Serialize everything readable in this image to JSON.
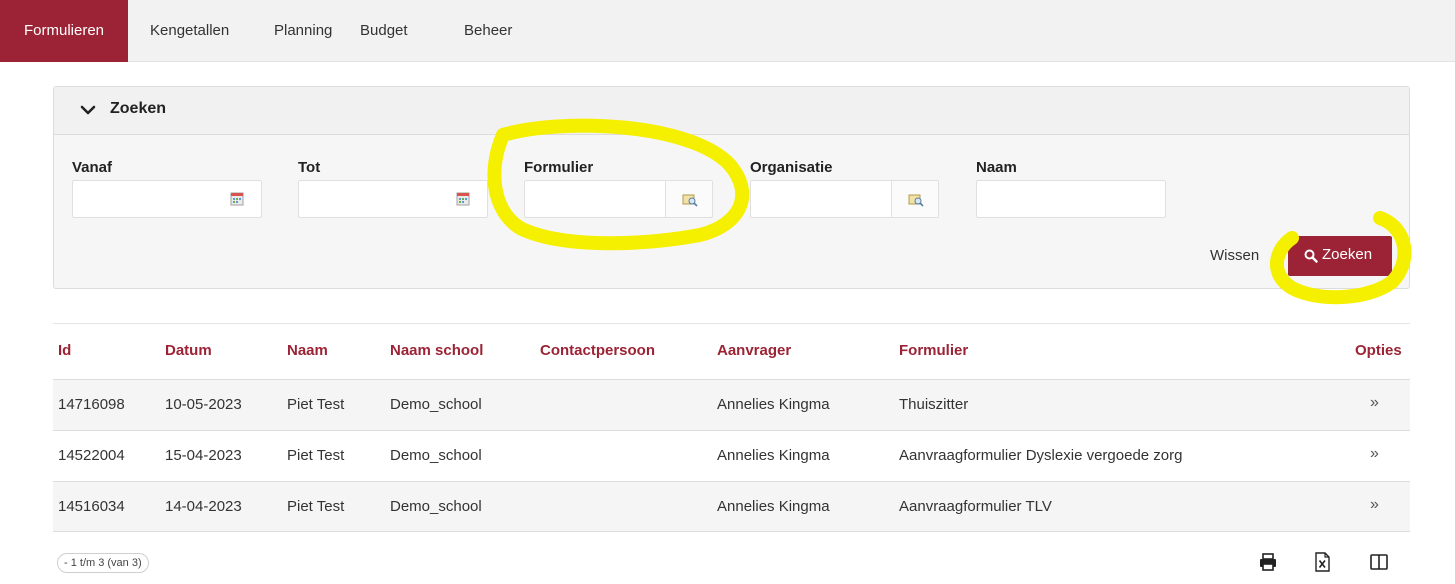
{
  "nav": {
    "tabs": [
      "Formulieren",
      "Kengetallen",
      "Planning",
      "Budget",
      "Beheer"
    ],
    "active_index": 0
  },
  "search_panel": {
    "title": "Zoeken",
    "fields": {
      "vanaf": {
        "label": "Vanaf",
        "value": ""
      },
      "tot": {
        "label": "Tot",
        "value": ""
      },
      "formulier": {
        "label": "Formulier",
        "value": ""
      },
      "organisatie": {
        "label": "Organisatie",
        "value": ""
      },
      "naam": {
        "label": "Naam",
        "value": ""
      }
    },
    "clear_label": "Wissen",
    "search_label": "Zoeken"
  },
  "table": {
    "headers": {
      "id": "Id",
      "datum": "Datum",
      "naam": "Naam",
      "naam_school": "Naam school",
      "contactpersoon": "Contactpersoon",
      "aanvrager": "Aanvrager",
      "formulier": "Formulier",
      "opties": "Opties"
    },
    "rows": [
      {
        "id": "14716098",
        "datum": "10-05-2023",
        "naam": "Piet Test",
        "naam_school": "Demo_school",
        "contactpersoon": "",
        "aanvrager": "Annelies Kingma",
        "formulier": "Thuiszitter",
        "opties": "»"
      },
      {
        "id": "14522004",
        "datum": "15-04-2023",
        "naam": "Piet Test",
        "naam_school": "Demo_school",
        "contactpersoon": "",
        "aanvrager": "Annelies Kingma",
        "formulier": "Aanvraagformulier Dyslexie vergoede zorg",
        "opties": "»"
      },
      {
        "id": "14516034",
        "datum": "14-04-2023",
        "naam": "Piet Test",
        "naam_school": "Demo_school",
        "contactpersoon": "",
        "aanvrager": "Annelies Kingma",
        "formulier": "Aanvraagformulier TLV",
        "opties": "»"
      }
    ],
    "pager": "- 1 t/m 3 (van 3)"
  },
  "icons": {
    "collapse": "chevron-down-icon",
    "date": "calendar-icon",
    "lookup": "lookup-icon",
    "search": "search-icon",
    "print": "print-icon",
    "excel": "excel-icon",
    "columns": "columns-icon"
  },
  "colors": {
    "brand": "#9b2335",
    "highlight": "#f5ef00"
  }
}
